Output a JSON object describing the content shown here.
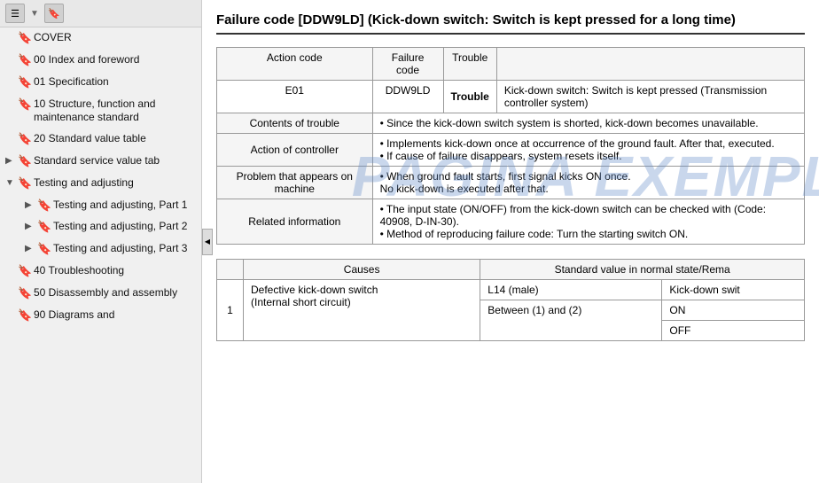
{
  "sidebar": {
    "toolbar": {
      "icon1": "☰",
      "icon2": "🔖"
    },
    "items": [
      {
        "id": "cover",
        "label": "COVER",
        "hasArrow": false,
        "hasExpand": false
      },
      {
        "id": "00-index",
        "label": "00 Index and foreword",
        "hasArrow": false,
        "hasExpand": false
      },
      {
        "id": "01-spec",
        "label": "01 Specification",
        "hasArrow": false,
        "hasExpand": false
      },
      {
        "id": "10-struct",
        "label": "10 Structure, function and maintenance standard",
        "hasArrow": false,
        "hasExpand": false
      },
      {
        "id": "20-std",
        "label": "20 Standard value table",
        "hasArrow": false,
        "hasExpand": false
      },
      {
        "id": "std-svc",
        "label": "Standard service value tab",
        "hasArrow": true,
        "expanded": false
      },
      {
        "id": "testing-adj",
        "label": "Testing and adjusting",
        "hasArrow": true,
        "expanded": true
      },
      {
        "id": "testing-adj-p1",
        "label": "Testing and adjusting, Part 1",
        "hasArrow": true,
        "expanded": false,
        "indent": true
      },
      {
        "id": "testing-adj-p2",
        "label": "Testing and adjusting, Part 2",
        "hasArrow": true,
        "expanded": false,
        "indent": true
      },
      {
        "id": "testing-adj-p3",
        "label": "Testing and adjusting, Part 3",
        "hasArrow": true,
        "expanded": false,
        "indent": true
      },
      {
        "id": "40-trouble",
        "label": "40 Troubleshooting",
        "hasArrow": false,
        "hasExpand": false
      },
      {
        "id": "50-disassembly",
        "label": "50 Disassembly and assembly",
        "hasArrow": false,
        "hasExpand": false
      },
      {
        "id": "90-diagrams",
        "label": "90 Diagrams and",
        "hasArrow": false,
        "hasExpand": false
      }
    ]
  },
  "main": {
    "title": "Failure code [DDW9LD] (Kick-down switch: Switch is kept pressed for a long time)",
    "failure_table": {
      "headers": [
        "Action code",
        "Failure code",
        "Trouble"
      ],
      "action_code": "E01",
      "failure_code": "DDW9LD",
      "trouble_desc": "Kick-down switch: Switch is kept pressed (Transmission controller system)",
      "rows": [
        {
          "header": "Contents of trouble",
          "content": "• Since the kick-down switch system is shorted, kick-down becomes unavailable."
        },
        {
          "header": "Action of controller",
          "content": "• Implements kick-down once at occurrence of the ground fault. After that, executed.\n• If cause of failure disappears, system resets itself."
        },
        {
          "header": "Problem that appears on machine",
          "content": "• When ground fault starts, first signal kicks ON once.\n  No kick-down is executed after that."
        },
        {
          "header": "Related information",
          "content": "• The input state (ON/OFF) from the kick-down switch can be checked with (Code: 40908, D-IN-30).\n• Method of reproducing failure code: Turn the starting switch ON."
        }
      ]
    },
    "causes_table": {
      "headers": [
        "Causes",
        "Standard value in normal state/Rema"
      ],
      "rows": [
        {
          "no": "1",
          "cause": "Defective kick-down switch (Internal short circuit)",
          "sub_rows": [
            {
              "condition": "L14 (male)",
              "value_header": "Kick-down swit",
              "values": [
                {
                  "label": "ON",
                  "value": ""
                },
                {
                  "label": "OFF",
                  "value": ""
                }
              ]
            },
            {
              "condition": "Between (1) and (2)",
              "values": [
                {
                  "label": "ON",
                  "value": ""
                },
                {
                  "label": "OFF",
                  "value": ""
                }
              ]
            }
          ]
        }
      ]
    }
  },
  "watermark": "PAGINA EXEMPLU"
}
